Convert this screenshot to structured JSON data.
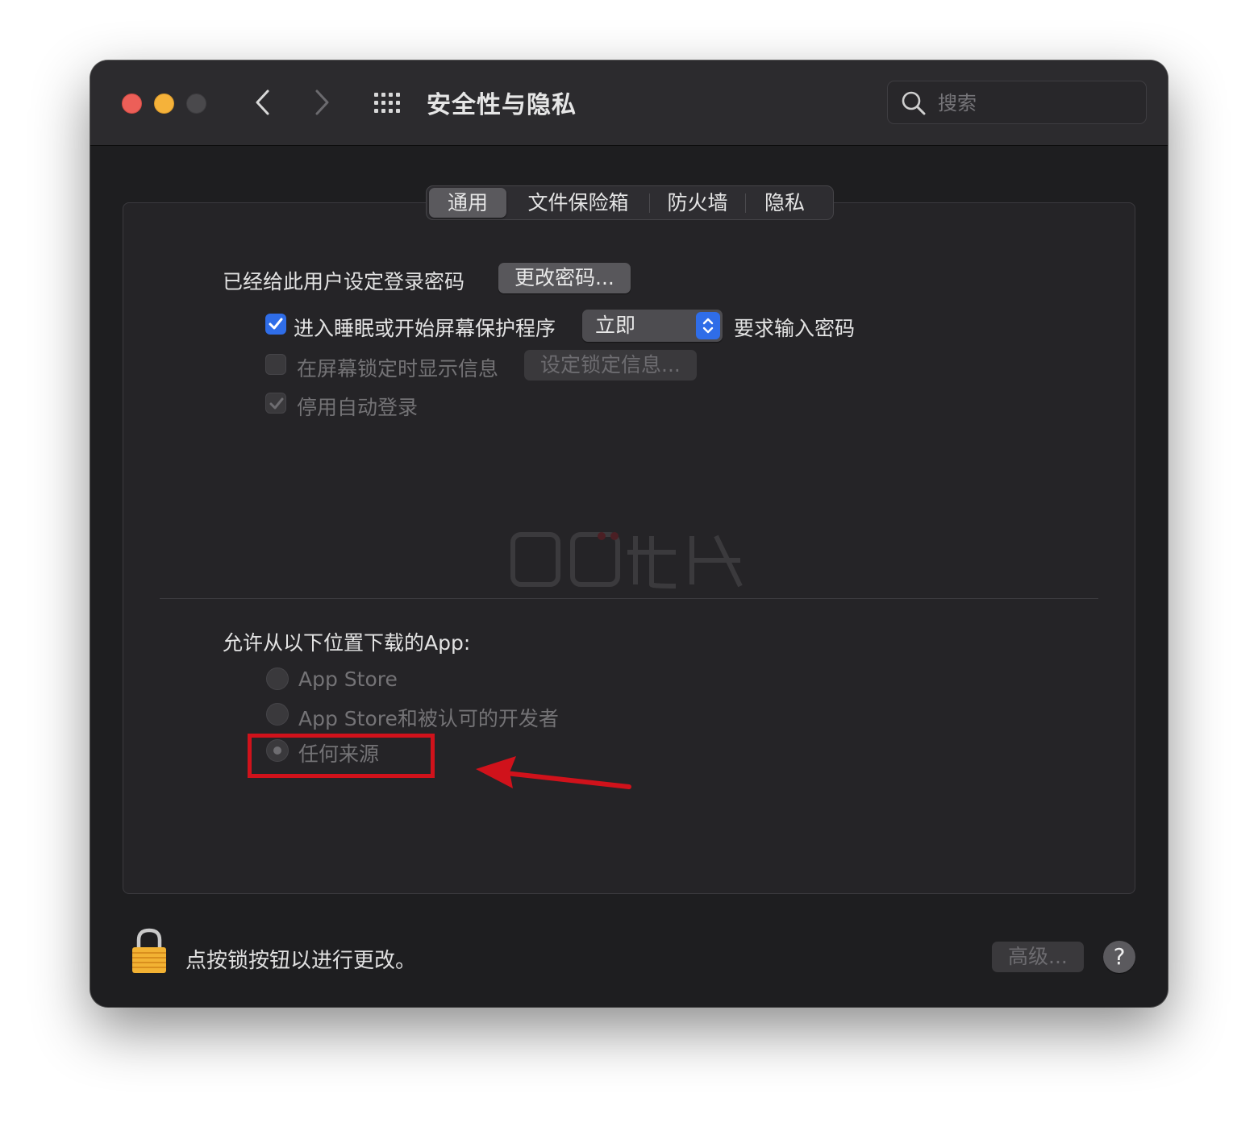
{
  "window": {
    "title": "安全性与隐私"
  },
  "search": {
    "placeholder": "搜索"
  },
  "tabs": [
    {
      "label": "通用",
      "active": true
    },
    {
      "label": "文件保险箱",
      "active": false
    },
    {
      "label": "防火墙",
      "active": false
    },
    {
      "label": "隐私",
      "active": false
    }
  ],
  "general": {
    "password_label": "已经给此用户设定登录密码",
    "change_password_button": "更改密码...",
    "require_password": {
      "checked": true,
      "label": "进入睡眠或开始屏幕保护程序",
      "delay_value": "立即",
      "suffix": "要求输入密码"
    },
    "show_message": {
      "checked": false,
      "label": "在屏幕锁定时显示信息",
      "button": "设定锁定信息..."
    },
    "disable_autologin": {
      "checked": true,
      "label": "停用自动登录"
    }
  },
  "downloads": {
    "heading": "允许从以下位置下载的App:",
    "options": [
      {
        "label": "App Store",
        "selected": false
      },
      {
        "label": "App Store和被认可的开发者",
        "selected": false
      },
      {
        "label": "任何来源",
        "selected": true
      }
    ]
  },
  "footer": {
    "lock_text": "点按锁按钮以进行更改。",
    "advanced_button": "高级...",
    "help_label": "?"
  },
  "colors": {
    "accent": "#2f6de8",
    "annotation": "#d0121b",
    "lock": "#f2b233"
  }
}
